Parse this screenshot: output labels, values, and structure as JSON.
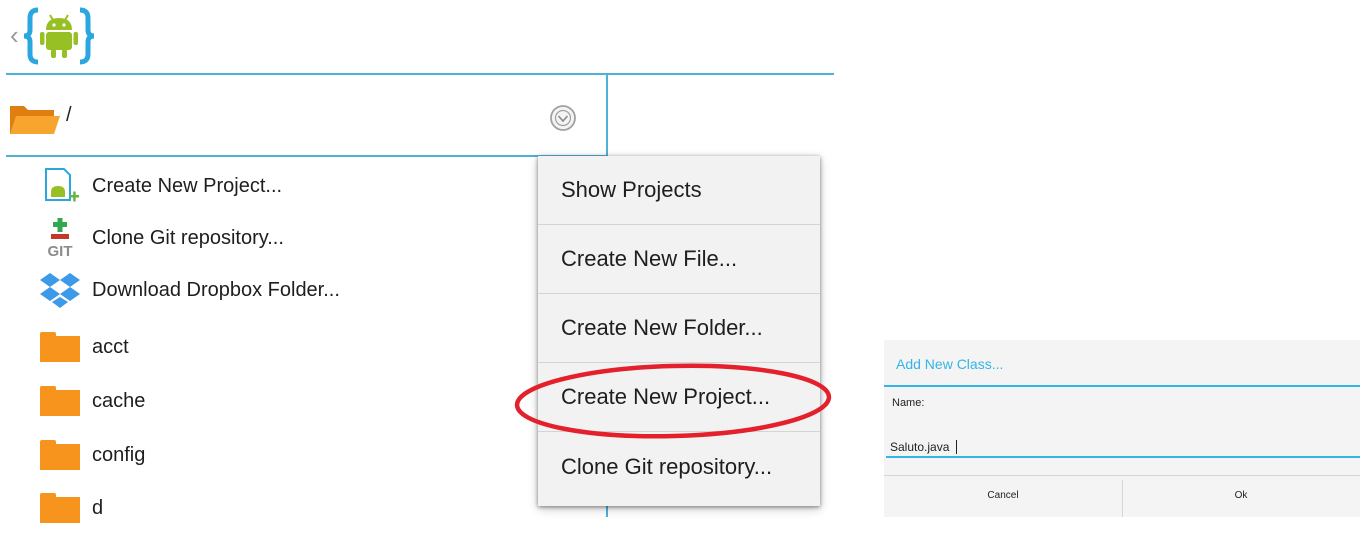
{
  "header": {
    "back_glyph": "‹",
    "logo_icon": "android-braces-logo"
  },
  "path_bar": {
    "path": "/",
    "folder_icon": "folder-open-icon",
    "dropdown_icon": "circle-chevron-down-icon"
  },
  "file_list": {
    "actions": [
      {
        "label": "Create New Project...",
        "icon": "new-project-icon"
      },
      {
        "label": "Clone Git repository...",
        "icon": "git-plus-icon"
      },
      {
        "label": "Download Dropbox Folder...",
        "icon": "dropbox-icon"
      }
    ],
    "folders": [
      {
        "label": "acct"
      },
      {
        "label": "cache"
      },
      {
        "label": "config"
      },
      {
        "label": "d"
      }
    ]
  },
  "context_menu": {
    "items": [
      {
        "label": "Show Projects"
      },
      {
        "label": "Create New File..."
      },
      {
        "label": "Create New Folder..."
      },
      {
        "label": "Create New Project..."
      },
      {
        "label": "Clone Git repository..."
      }
    ],
    "highlighted_index": 3
  },
  "dialog": {
    "title": "Add New Class...",
    "name_label": "Name:",
    "name_value": "Saluto.java",
    "cancel_label": "Cancel",
    "ok_label": "Ok"
  },
  "colors": {
    "accent": "#33b5e5",
    "folder": "#f7941d",
    "highlight_ellipse": "#e3202b"
  }
}
